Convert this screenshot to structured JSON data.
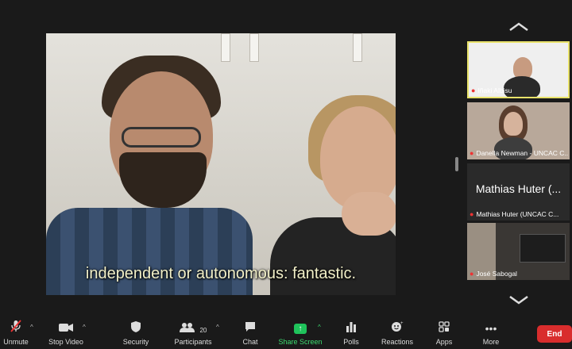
{
  "main_video": {
    "subtitle": "independent or autonomous: fantastic."
  },
  "gallery": {
    "participants": [
      {
        "name": "Iñaki Albisu",
        "muted": true,
        "video": true,
        "active": true
      },
      {
        "name": "Danella Newman - UNCAC C...",
        "muted": true,
        "video": true,
        "active": false
      },
      {
        "name": "Mathias Huter (UNCAC C...",
        "display_name": "Mathias Huter (...",
        "muted": true,
        "video": false,
        "active": false
      },
      {
        "name": "José Sabogal",
        "muted": true,
        "video": true,
        "active": false
      }
    ]
  },
  "toolbar": {
    "unmute": "Unmute",
    "stop_video": "Stop Video",
    "security": "Security",
    "participants": "Participants",
    "participants_count": "20",
    "chat": "Chat",
    "share_screen": "Share Screen",
    "polls": "Polls",
    "reactions": "Reactions",
    "apps": "Apps",
    "more": "More",
    "end": "End"
  },
  "icons": {
    "unmute": "mic-off-icon",
    "stop_video": "video-camera-icon",
    "security": "shield-icon",
    "participants": "people-icon",
    "chat": "chat-bubble-icon",
    "share_screen": "share-arrow-icon",
    "polls": "bar-chart-icon",
    "reactions": "smiley-add-icon",
    "apps": "apps-icon",
    "more": "ellipsis-icon"
  },
  "colors": {
    "background": "#1a1a1a",
    "active_speaker_border": "#e8e26a",
    "share_green": "#1fc35b",
    "end_red": "#d92d2d",
    "muted_red": "#e33333"
  }
}
